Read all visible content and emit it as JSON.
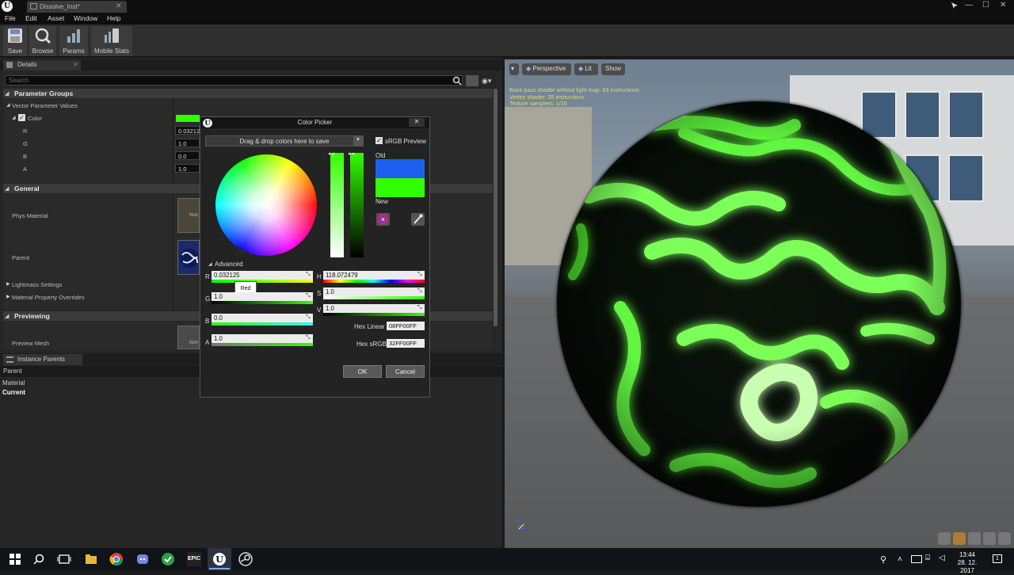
{
  "window": {
    "tab_title": "Dissolve_Inst*",
    "controls": [
      "—",
      "☐",
      "✕"
    ]
  },
  "menu": [
    "File",
    "Edit",
    "Asset",
    "Window",
    "Help"
  ],
  "toolbar": [
    {
      "label": "Save",
      "icon": "save-icon"
    },
    {
      "label": "Browse",
      "icon": "browse-icon"
    },
    {
      "label": "Params",
      "icon": "params-icon"
    },
    {
      "label": "Mobile Stats",
      "icon": "mobile-stats-icon"
    }
  ],
  "details": {
    "tab_label": "Details",
    "search_placeholder": "Search",
    "param_groups": "Parameter Groups",
    "vector_values": "Vector Parameter Values",
    "color_label": "Color",
    "channels": [
      {
        "label": "R",
        "value": "0.03212"
      },
      {
        "label": "G",
        "value": "1.0"
      },
      {
        "label": "B",
        "value": "0.0"
      },
      {
        "label": "A",
        "value": "1.0"
      }
    ],
    "general": "General",
    "phys_material": "Phys Material",
    "parent": "Parent",
    "lightmass": "Lightmass Settings",
    "overrides": "Material Property Overrides",
    "previewing": "Previewing",
    "preview_mesh": "Preview Mesh",
    "thumb_none": "None",
    "thumb_none_short": "Non"
  },
  "instance_parents": {
    "tab_label": "Instance Parents",
    "header": "Parent",
    "rows": [
      "Material",
      "Current"
    ]
  },
  "viewport": {
    "buttons": [
      "Perspective",
      "Lit",
      "Show"
    ],
    "stats": [
      "Base pass shader without light map: 63 instructions",
      "Vertex shader: 35 instructions",
      "Texture samplers: 1/16"
    ]
  },
  "picker": {
    "title": "Color Picker",
    "drop_zone": "Drag & drop colors here to save",
    "srgb_preview": "sRGB Preview",
    "old_label": "Old",
    "new_label": "New",
    "advanced": "Advanced",
    "rgba": [
      {
        "label": "R",
        "value": "0.032125"
      },
      {
        "label": "G",
        "value": "1.0"
      },
      {
        "label": "B",
        "value": "0.0"
      },
      {
        "label": "A",
        "value": "1.0"
      }
    ],
    "hsv": [
      {
        "label": "H",
        "value": "118.072479"
      },
      {
        "label": "S",
        "value": "1.0"
      },
      {
        "label": "V",
        "value": "1.0"
      }
    ],
    "tooltip": "Red",
    "hex_linear_label": "Hex Linear",
    "hex_linear": "08FF00FF",
    "hex_srgb_label": "Hex sRGB",
    "hex_srgb": "32FF00FF",
    "ok": "OK",
    "cancel": "Cancel",
    "old_color": "#1e5ff0",
    "new_color": "#32ff00"
  },
  "taskbar": {
    "time": "13:44",
    "date": "28. 12. 2017",
    "icons": [
      "windows-start-icon",
      "search-icon",
      "task-view-icon",
      "file-explorer-icon",
      "chrome-icon",
      "discord-icon",
      "app-icon",
      "epic-games-icon",
      "unreal-engine-icon",
      "steam-icon"
    ],
    "epic_label": "EPIC"
  },
  "colors": {
    "accent_green": "#32ff00",
    "panel": "#262626",
    "section": "#3b3b3b"
  }
}
